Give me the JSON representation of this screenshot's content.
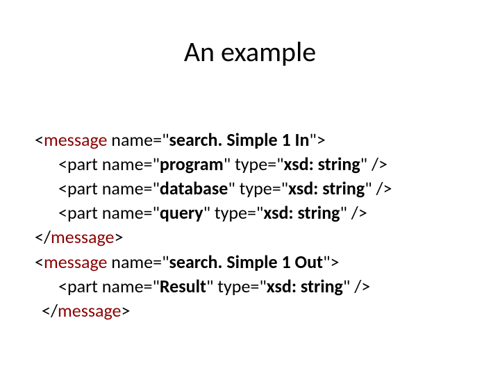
{
  "title": "An example",
  "l1_a": "<",
  "l1_b": "message",
  "l1_c": " name=\"",
  "l1_d": "search. Simple 1 In",
  "l1_e": "\">",
  "l2_a": "<part name=\"",
  "l2_b": "program",
  "l2_c": "\" type=\"",
  "l2_d": "xsd: string",
  "l2_e": "\" />",
  "l3_a": "<part name=\"",
  "l3_b": "database",
  "l3_c": "\" type=\"",
  "l3_d": "xsd: string",
  "l3_e": "\" />",
  "l4_a": "<part name=\"",
  "l4_b": "query",
  "l4_c": "\" type=\"",
  "l4_d": "xsd: string",
  "l4_e": "\" />",
  "l5_a": "</",
  "l5_b": "message",
  "l5_c": ">",
  "l6_a": "<",
  "l6_b": "message",
  "l6_c": " name=\"",
  "l6_d": "search. Simple 1 Out",
  "l6_e": "\">",
  "l7_a": "<part name=\"",
  "l7_b": "Result",
  "l7_c": "\" type=\"",
  "l7_d": "xsd: string",
  "l7_e": "\" />",
  "l8_a": "</",
  "l8_b": "message",
  "l8_c": ">"
}
